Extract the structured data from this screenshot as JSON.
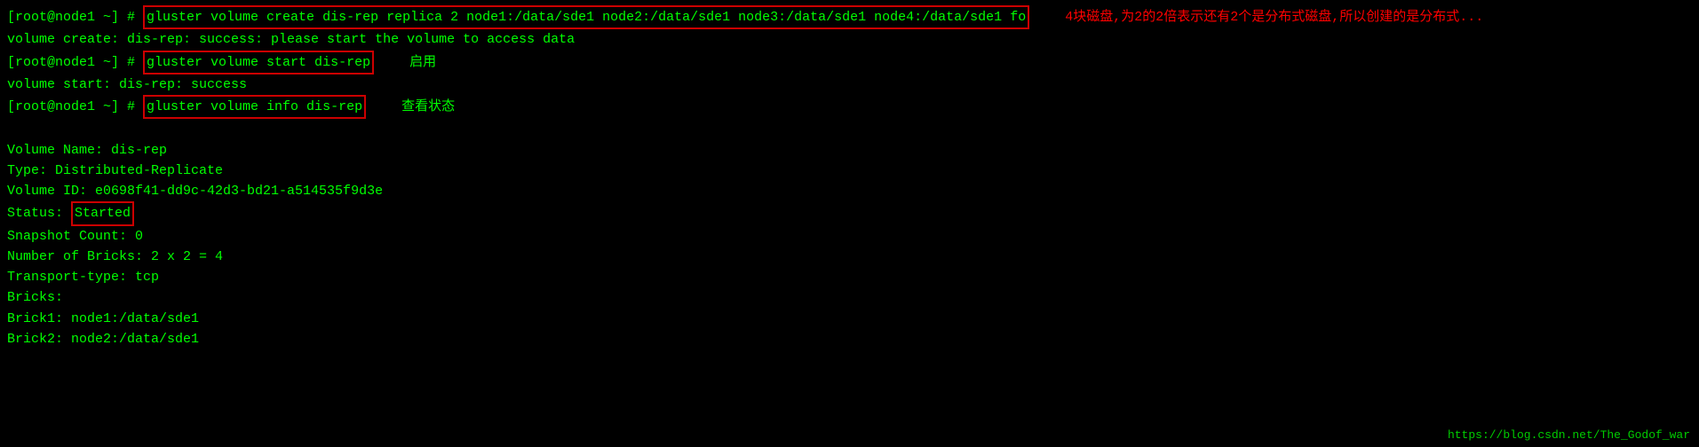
{
  "terminal": {
    "bg": "#000000",
    "lines": [
      {
        "type": "command",
        "prompt": "[root@node1 ~] # ",
        "cmd": "gluster volume create dis-rep replica 2 node1:/data/sde1 node2:/data/sde1 node3:/data/sde1 node4:/data/sde1 fo",
        "annotation": "4块磁盘,为2的2倍表示还有2个是分布式磁盘,所以创建的是分布式...",
        "annotation_color": "red"
      },
      {
        "type": "result",
        "text": "volume create: dis-rep: success: please start the volume to access data"
      },
      {
        "type": "command",
        "prompt": "[root@node1 ~] # ",
        "cmd": "gluster volume start dis-rep",
        "annotation": "启用",
        "annotation_color": "green"
      },
      {
        "type": "result",
        "text": "volume start: dis-rep: success"
      },
      {
        "type": "command",
        "prompt": "[root@node1 ~] # ",
        "cmd": "gluster volume info dis-rep",
        "annotation": "查看状态",
        "annotation_color": "green"
      },
      {
        "type": "blank"
      },
      {
        "type": "info",
        "text": "Volume Name: dis-rep"
      },
      {
        "type": "info",
        "text": "Type: Distributed-Replicate"
      },
      {
        "type": "info",
        "text": "Volume ID: e0698f41-dd9c-42d3-bd21-a514535f9d3e"
      },
      {
        "type": "info_status",
        "prefix": "Status: ",
        "status": "Started"
      },
      {
        "type": "info",
        "text": "Snapshot Count: 0"
      },
      {
        "type": "info",
        "text": "Number of Bricks: 2 x 2 = 4"
      },
      {
        "type": "info",
        "text": "Transport-type: tcp"
      },
      {
        "type": "info",
        "text": "Bricks:"
      },
      {
        "type": "info",
        "text": "Brick1: node1:/data/sde1"
      },
      {
        "type": "info",
        "text": "Brick2: node2:/data/sde1"
      }
    ],
    "footer_url": "https://blog.csdn.net/The_Godof_war"
  }
}
